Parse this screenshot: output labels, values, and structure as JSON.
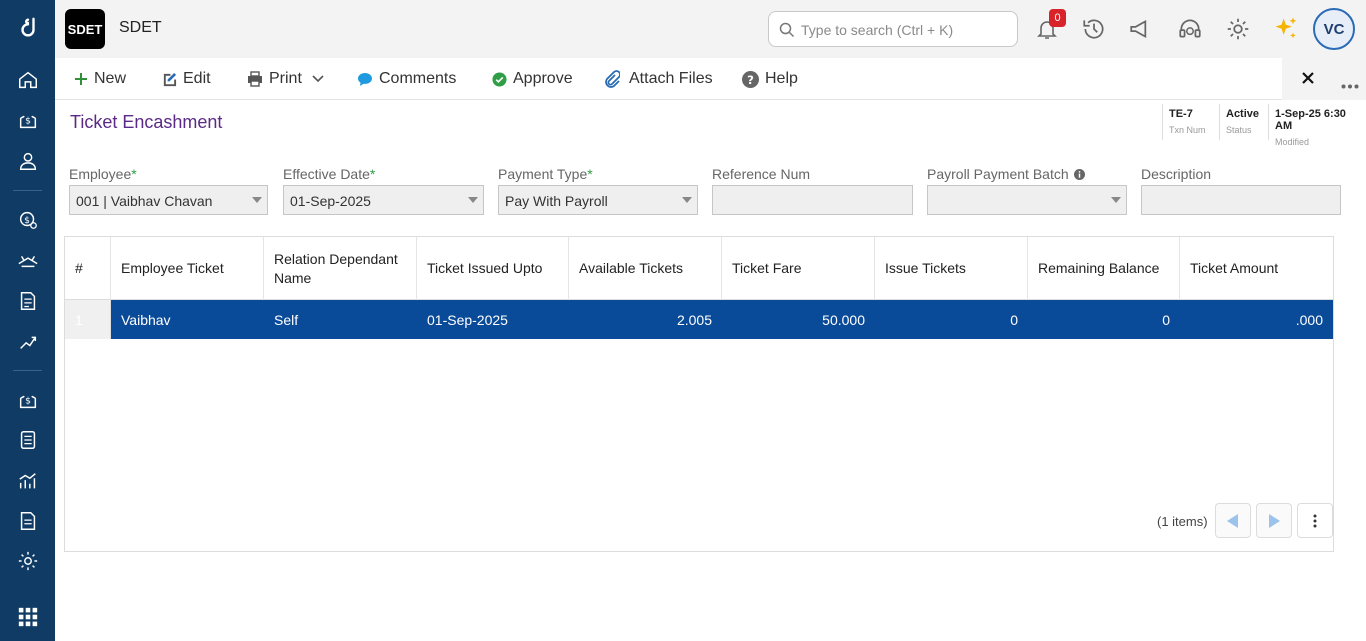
{
  "app": {
    "logo": "SDET",
    "title": "SDET"
  },
  "search": {
    "placeholder": "Type to search (Ctrl + K)"
  },
  "notifications": {
    "count": "0"
  },
  "user": {
    "initials": "VC"
  },
  "toolbar": {
    "new_label": "New",
    "edit_label": "Edit",
    "print_label": "Print",
    "comments_label": "Comments",
    "approve_label": "Approve",
    "attach_label": "Attach Files",
    "help_label": "Help"
  },
  "page": {
    "title": "Ticket Encashment"
  },
  "meta": [
    {
      "value": "TE-7",
      "label": "Txn Num"
    },
    {
      "value": "Active",
      "label": "Status"
    },
    {
      "value": "1-Sep-25 6:30 AM",
      "label": "Modified"
    }
  ],
  "form": {
    "employee": {
      "label": "Employee",
      "value": "001 | Vaibhav Chavan"
    },
    "effective_date": {
      "label": "Effective Date",
      "value": "01-Sep-2025"
    },
    "payment_type": {
      "label": "Payment Type",
      "value": "Pay With Payroll"
    },
    "reference_num": {
      "label": "Reference Num",
      "value": ""
    },
    "payroll_batch": {
      "label": "Payroll Payment Batch",
      "value": ""
    },
    "description": {
      "label": "Description",
      "value": ""
    }
  },
  "grid": {
    "columns": [
      "#",
      "Employee Ticket",
      "Relation Dependant Name",
      "Ticket Issued Upto",
      "Available Tickets",
      "Ticket Fare",
      "Issue Tickets",
      "Remaining Balance",
      "Ticket Amount"
    ],
    "rows": [
      [
        "1",
        "Vaibhav",
        "Self",
        "01-Sep-2025",
        "2.005",
        "50.000",
        "0",
        "0",
        ".000"
      ]
    ],
    "items_text": "(1 items)"
  },
  "colors": {
    "sidebar": "#0f3b64",
    "selected_row": "#0a4b99",
    "title": "#5b2a86",
    "accent": "#2a6bb5"
  }
}
